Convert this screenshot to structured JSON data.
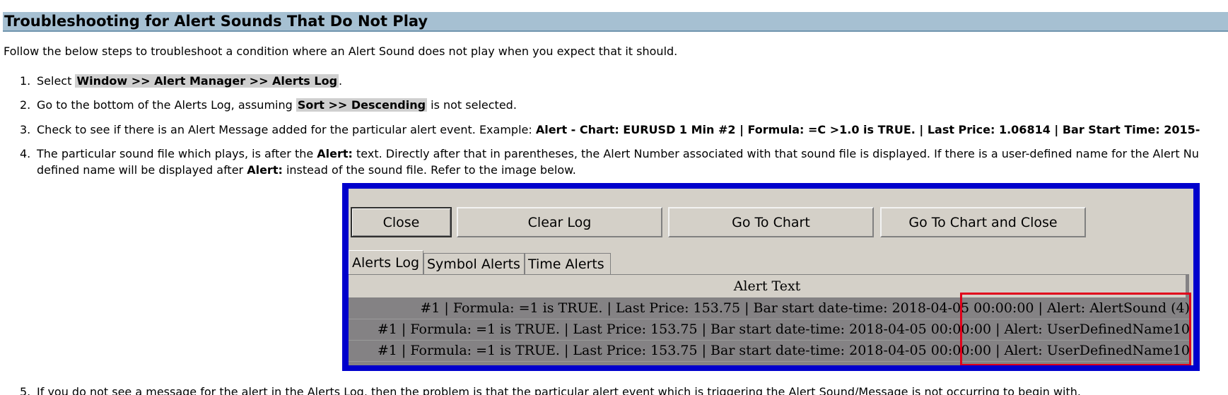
{
  "heading": "Troubleshooting for Alert Sounds That Do Not Play",
  "intro": "Follow the below steps to troubleshoot a condition where an Alert Sound does not play when you expect that it should.",
  "steps": {
    "s1": {
      "num": "1.",
      "pre": "Select ",
      "hl": "Window >> Alert Manager >> Alerts Log",
      "post": "."
    },
    "s2": {
      "num": "2.",
      "pre": "Go to the bottom of the Alerts Log, assuming ",
      "hl": "Sort >> Descending",
      "post": " is not selected."
    },
    "s3": {
      "num": "3.",
      "pre": "Check to see if there is an Alert Message added for the particular alert event. Example: ",
      "bold": "Alert - Chart: EURUSD 1 Min #2 | Formula: =C >1.0 is TRUE. | Last Price: 1.06814 | Bar Start Time: 2015-"
    },
    "s4": {
      "num": "4.",
      "line1_a": "The particular sound file which plays, is after the ",
      "line1_b": "Alert:",
      "line1_c": " text. Directly after that in parentheses, the Alert Number associated with that sound file is displayed. If there is a user-defined name for the Alert Nu",
      "line2_a": "defined name will be displayed after ",
      "line2_b": "Alert:",
      "line2_c": " instead of the sound file. Refer to the image below."
    },
    "s5": {
      "num": "5.",
      "text": "If you do not see a message for the alert in the Alerts Log, then the problem is that the particular alert event which is triggering the Alert Sound/Message is not occurring to begin with."
    }
  },
  "figure": {
    "buttons": {
      "close": "Close",
      "clear_log": "Clear Log",
      "go_to_chart": "Go To Chart",
      "go_to_chart_close": "Go To Chart and Close"
    },
    "tabs": {
      "alerts_log": "Alerts Log",
      "symbol_alerts": "Symbol Alerts",
      "time_alerts": "Time Alerts"
    },
    "column_header": "Alert Text",
    "rows": [
      "#1 | Formula: =1 is TRUE. | Last Price: 153.75 | Bar start date-time: 2018-04-05  00:00:00 | Alert: AlertSound (4)",
      "#1 | Formula: =1 is TRUE. | Last Price: 153.75 | Bar start date-time: 2018-04-05  00:00:00 | Alert: UserDefinedName10",
      "#1 | Formula: =1 is TRUE. | Last Price: 153.75 | Bar start date-time: 2018-04-05  00:00:00 | Alert: UserDefinedName10"
    ]
  }
}
